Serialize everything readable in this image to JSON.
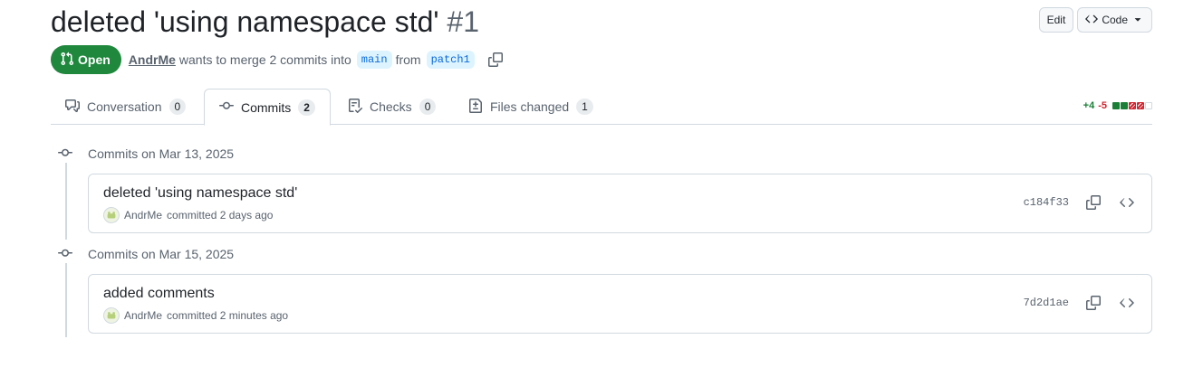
{
  "pr": {
    "title": "deleted 'using namespace std'",
    "number": "#1",
    "state": "Open",
    "author": "AndrMe",
    "merge_text": "wants to merge 2 commits into",
    "base_branch": "main",
    "from_text": "from",
    "head_branch": "patch1"
  },
  "header": {
    "edit_label": "Edit",
    "code_label": "Code"
  },
  "tabs": [
    {
      "label": "Conversation",
      "count": "0",
      "icon": "comment-discussion-icon"
    },
    {
      "label": "Commits",
      "count": "2",
      "icon": "git-commit-icon",
      "active": true
    },
    {
      "label": "Checks",
      "count": "0",
      "icon": "checklist-icon"
    },
    {
      "label": "Files changed",
      "count": "1",
      "icon": "file-diff-icon"
    }
  ],
  "diffstat": {
    "additions": "+4",
    "deletions": "-5",
    "blocks": [
      "green",
      "green",
      "red",
      "red",
      "empty"
    ]
  },
  "commit_groups": [
    {
      "date_label": "Commits on Mar 13, 2025",
      "commits": [
        {
          "message": "deleted 'using namespace std'",
          "author": "AndrMe",
          "time_text": "committed 2 days ago",
          "sha": "c184f33"
        }
      ]
    },
    {
      "date_label": "Commits on Mar 15, 2025",
      "commits": [
        {
          "message": "added comments",
          "author": "AndrMe",
          "time_text": "committed 2 minutes ago",
          "sha": "7d2d1ae"
        }
      ]
    }
  ],
  "colors": {
    "open_green": "#1f883d",
    "branch_bg": "#ddf4ff",
    "branch_fg": "#0969da",
    "additions": "#1a7f37",
    "deletions": "#d1242f"
  }
}
